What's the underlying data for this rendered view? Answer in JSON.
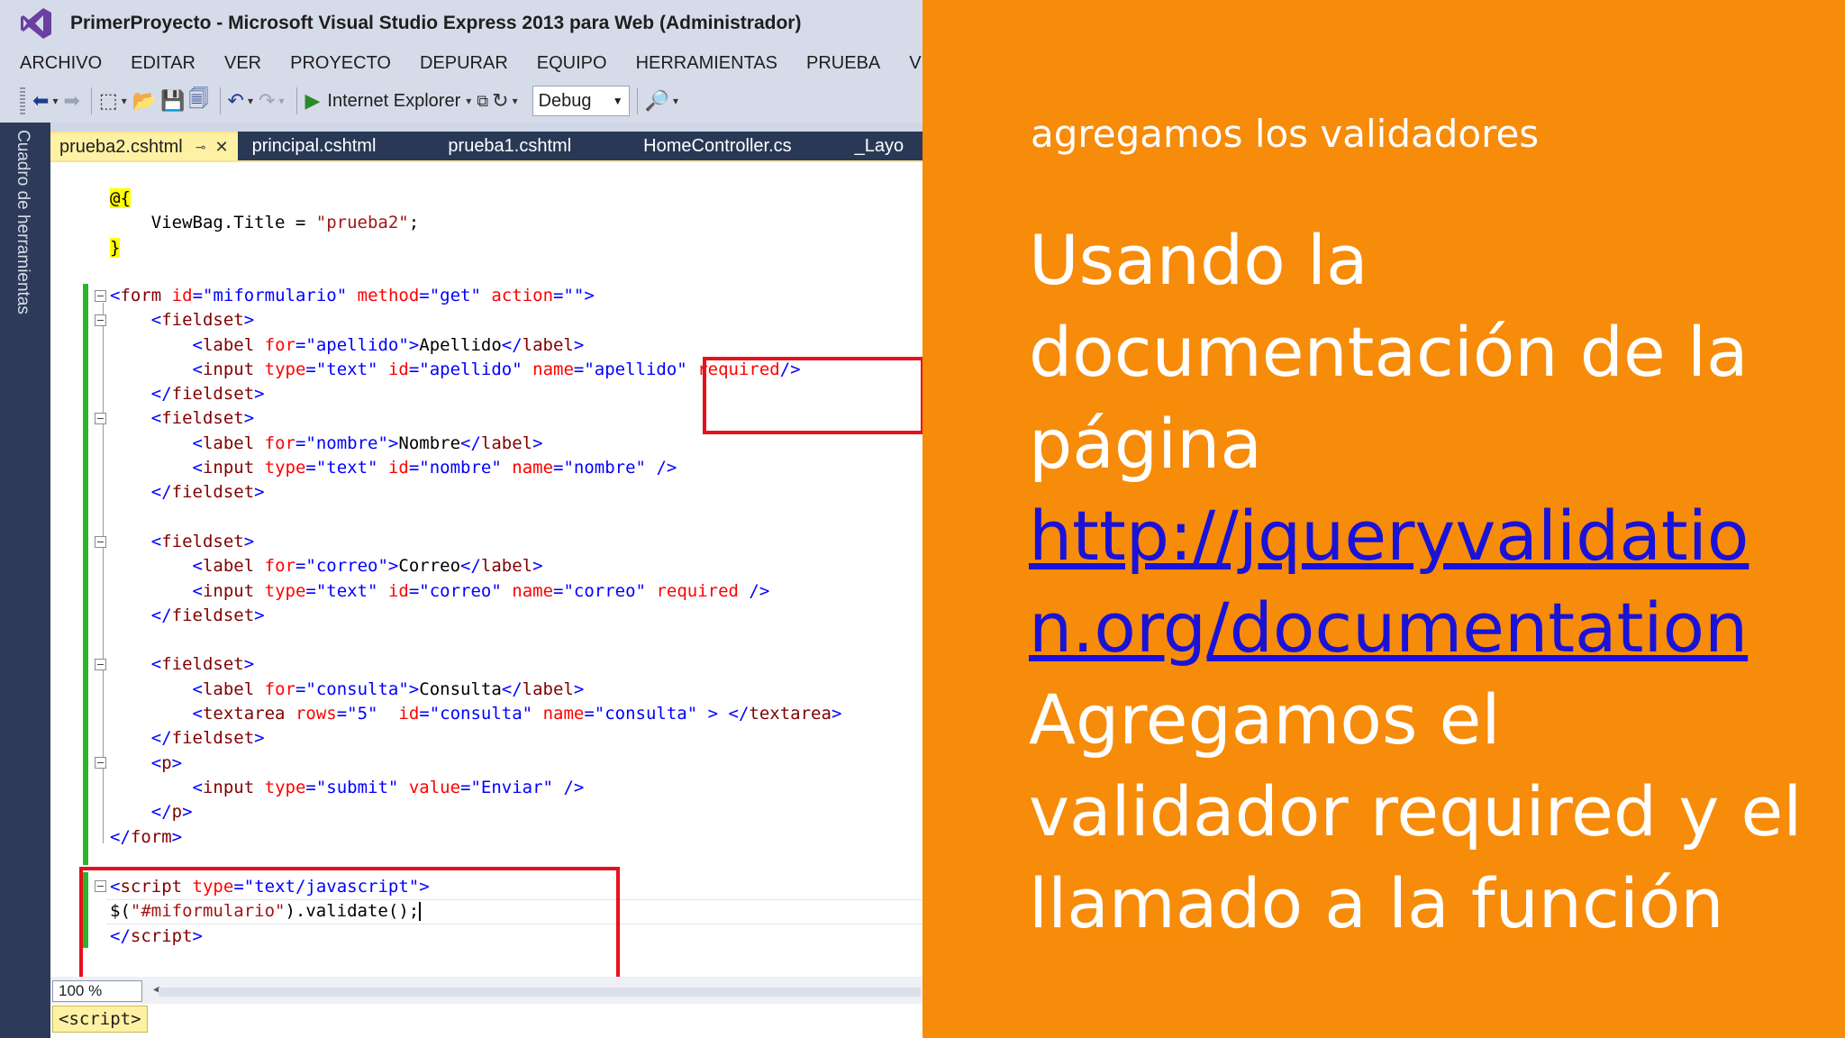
{
  "window": {
    "title": "PrimerProyecto - Microsoft Visual Studio Express 2013 para Web (Administrador)",
    "menu": [
      "ARCHIVO",
      "EDITAR",
      "VER",
      "PROYECTO",
      "DEPURAR",
      "EQUIPO",
      "HERRAMIENTAS",
      "PRUEBA",
      "VEN"
    ]
  },
  "toolbar": {
    "browser_label": "Internet Explorer",
    "config_value": "Debug"
  },
  "toolbox": {
    "label": "Cuadro de herramientas"
  },
  "tabs": [
    {
      "label": "prueba2.cshtml",
      "pin": "⊸",
      "close": "✕"
    },
    {
      "label": "principal.cshtml"
    },
    {
      "label": "prueba1.cshtml"
    },
    {
      "label": "HomeController.cs"
    },
    {
      "label": "_Layo"
    }
  ],
  "editor": {
    "zoom": "100 %",
    "breadcrumb": "<script>"
  },
  "colors": {
    "slide_background": "#f78b0a",
    "link": "#1a12d6",
    "highlight_box": "#e80f1d",
    "change_bar": "#2cb52c"
  },
  "slide": {
    "subtitle": "agregamos los validadores",
    "line1": "Usando la",
    "line2": "documentación de la",
    "line3": "página",
    "link_part1": "http://jqueryvalidatio",
    "link_part2": "n.org/documentation",
    "line4": "Agregamos el",
    "line5": "validador required y el",
    "line6": "llamado a la función"
  }
}
